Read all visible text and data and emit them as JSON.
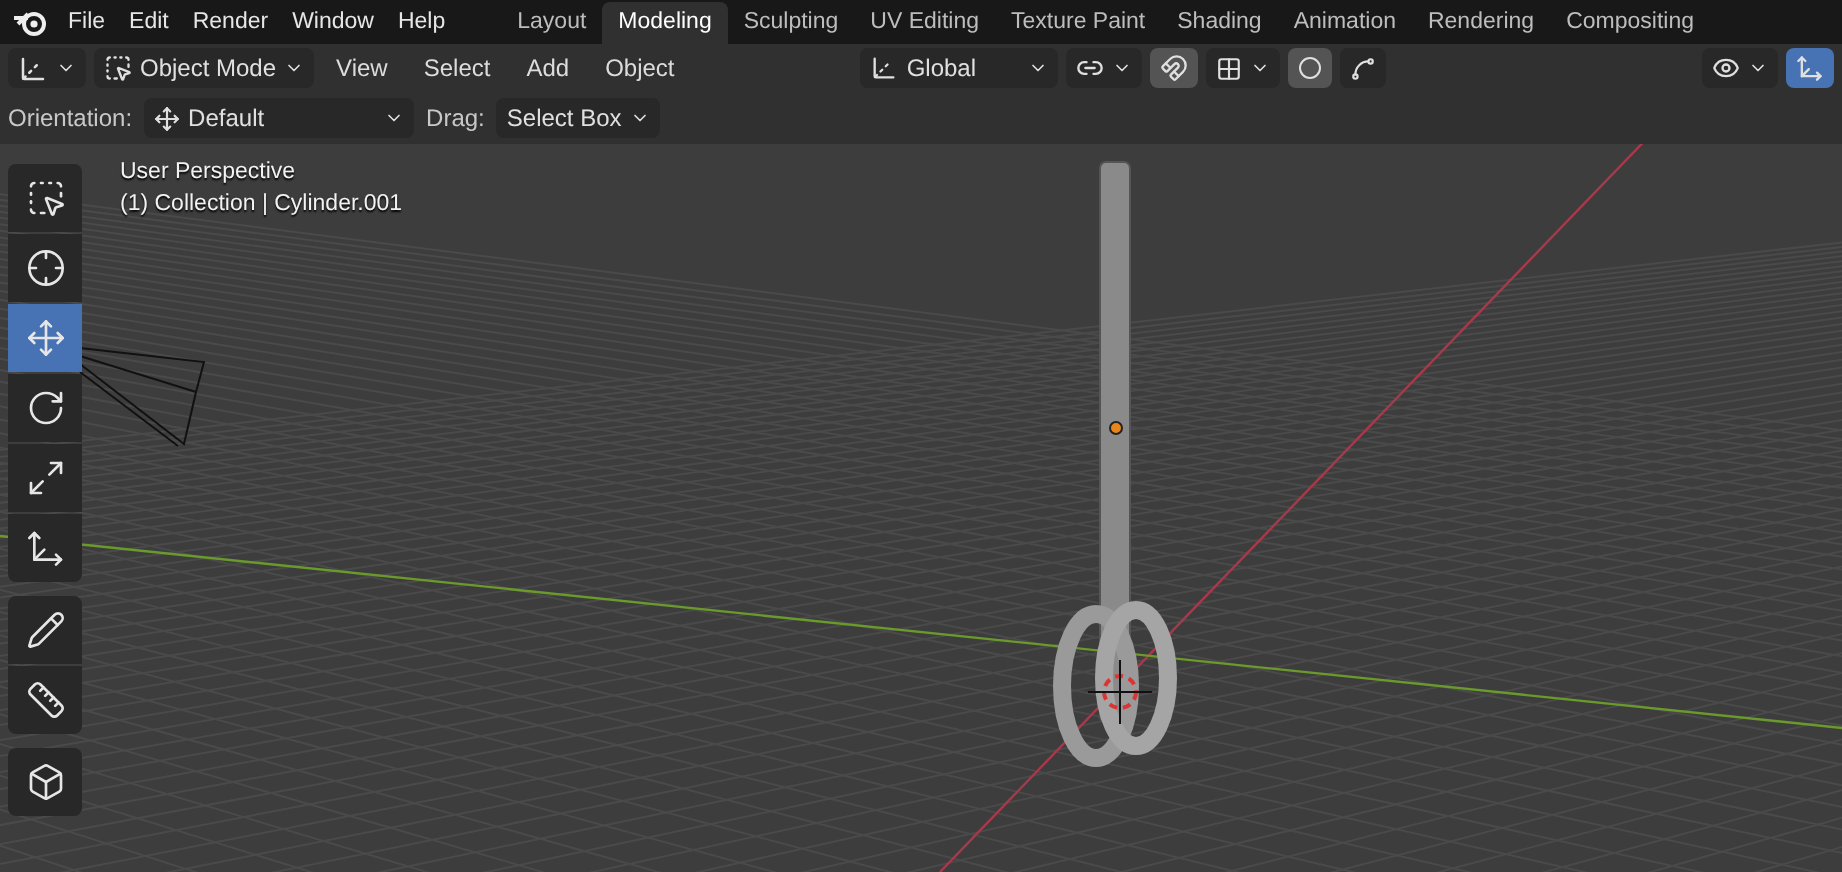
{
  "menu_bar": {
    "menus": [
      "File",
      "Edit",
      "Render",
      "Window",
      "Help"
    ],
    "workspaces": [
      {
        "label": "Layout",
        "selected": false
      },
      {
        "label": "Modeling",
        "selected": true
      },
      {
        "label": "Sculpting",
        "selected": false
      },
      {
        "label": "UV Editing",
        "selected": false
      },
      {
        "label": "Texture Paint",
        "selected": false
      },
      {
        "label": "Shading",
        "selected": false
      },
      {
        "label": "Animation",
        "selected": false
      },
      {
        "label": "Rendering",
        "selected": false
      },
      {
        "label": "Compositing",
        "selected": false
      }
    ]
  },
  "header": {
    "mode": "Object Mode",
    "menus": [
      "View",
      "Select",
      "Add",
      "Object"
    ],
    "transform_orientation": "Global"
  },
  "tool_settings": {
    "orientation_label": "Orientation:",
    "orientation_value": "Default",
    "drag_label": "Drag:",
    "drag_value": "Select Box"
  },
  "viewport": {
    "view_name": "User Perspective",
    "object_info": "(1) Collection | Cylinder.001"
  },
  "toolbar": {
    "groups": [
      {
        "tools": [
          {
            "kind": "select",
            "selected": false
          },
          {
            "kind": "cursor",
            "selected": false
          },
          {
            "kind": "move",
            "selected": true
          },
          {
            "kind": "rotate",
            "selected": false
          },
          {
            "kind": "scale",
            "selected": false
          },
          {
            "kind": "transform",
            "selected": false
          }
        ]
      },
      {
        "tools": [
          {
            "kind": "annotate",
            "selected": false
          },
          {
            "kind": "measure",
            "selected": false
          }
        ]
      },
      {
        "tools": [
          {
            "kind": "add_cube",
            "selected": false
          }
        ]
      }
    ]
  }
}
